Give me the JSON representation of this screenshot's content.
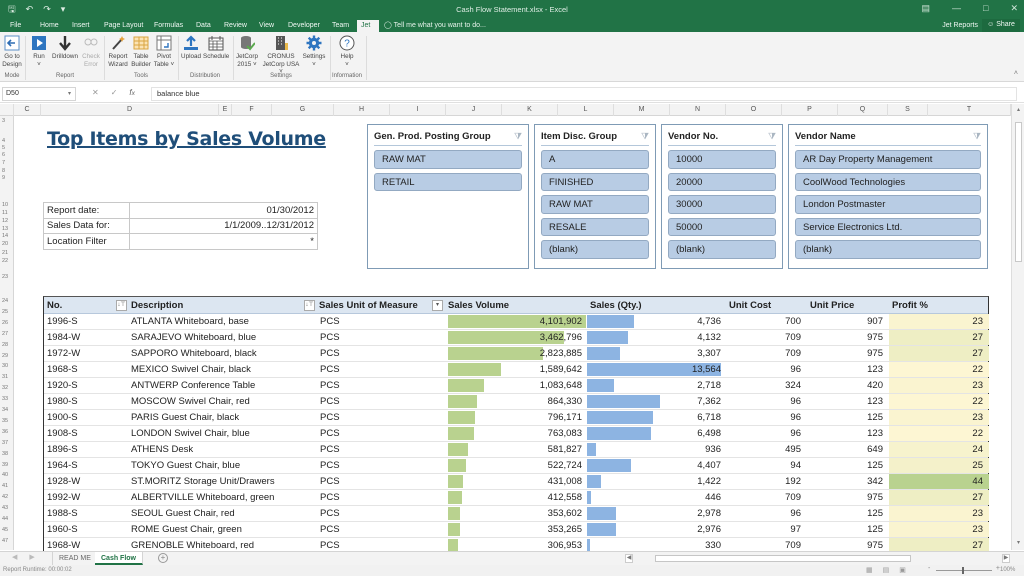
{
  "window": {
    "title": "Cash Flow Statement.xlsx - Excel",
    "qat": [
      "save-icon",
      "undo-icon",
      "redo-icon",
      "customize-icon"
    ],
    "controls": [
      "ribbon-display-icon",
      "minimize-icon",
      "maximize-icon",
      "close-icon"
    ]
  },
  "ribbon_tabs": {
    "items": [
      "File",
      "Home",
      "Insert",
      "Page Layout",
      "Formulas",
      "Data",
      "Review",
      "View",
      "Developer",
      "Team",
      "Jet"
    ],
    "active": "Jet",
    "tell_me": "Tell me what you want to do...",
    "account": "Jet Reports",
    "share": "Share"
  },
  "ribbon": {
    "groups": [
      {
        "name": "Mode",
        "buttons": [
          {
            "label1": "Go to",
            "label2": "Design",
            "icon": "go-to-design-icon"
          }
        ]
      },
      {
        "name": "Report",
        "buttons": [
          {
            "label1": "Run",
            "label2": "˅",
            "icon": "run-icon"
          },
          {
            "label1": "Drilldown",
            "label2": "",
            "icon": "drilldown-icon"
          },
          {
            "label1": "Check",
            "label2": "Error",
            "icon": "check-error-icon"
          }
        ]
      },
      {
        "name": "Tools",
        "buttons": [
          {
            "label1": "Report",
            "label2": "Wizard",
            "icon": "report-wizard-icon"
          },
          {
            "label1": "Table",
            "label2": "Builder",
            "icon": "table-builder-icon"
          },
          {
            "label1": "Pivot",
            "label2": "Table ˅",
            "icon": "pivot-table-icon"
          }
        ]
      },
      {
        "name": "Distribution",
        "buttons": [
          {
            "label1": "Upload",
            "label2": "",
            "icon": "upload-icon"
          },
          {
            "label1": "Schedule",
            "label2": "",
            "icon": "schedule-icon"
          }
        ]
      },
      {
        "name": "Settings",
        "buttons": [
          {
            "label1": "JetCorp",
            "label2": "2015 ˅",
            "icon": "database-icon"
          },
          {
            "label1": "CRONUS",
            "label2": "JetCorp USA ˅",
            "icon": "company-icon"
          },
          {
            "label1": "Settings",
            "label2": "˅",
            "icon": "gear-icon"
          }
        ]
      },
      {
        "name": "Information",
        "buttons": [
          {
            "label1": "Help",
            "label2": "˅",
            "icon": "help-icon"
          }
        ]
      }
    ]
  },
  "formula_bar": {
    "name_box": "D50",
    "formula": "balance blue"
  },
  "columns": [
    "C",
    "D",
    "E",
    "F",
    "G",
    "H",
    "I",
    "J",
    "K",
    "L",
    "M",
    "N",
    "O",
    "P",
    "Q",
    "S",
    "T"
  ],
  "rows": [
    "3",
    "4",
    "5",
    "6",
    "7",
    "8",
    "9",
    "10",
    "11",
    "12",
    "13",
    "14",
    "20",
    "21",
    "22",
    "23",
    "24",
    "25",
    "26",
    "27",
    "28",
    "29",
    "30",
    "31",
    "32",
    "33",
    "34",
    "35",
    "36",
    "37",
    "38",
    "39",
    "40",
    "41",
    "42",
    "43",
    "44",
    "45",
    "47"
  ],
  "sheet": {
    "title": "Top Items by Sales Volume",
    "info": [
      {
        "label": "Report date:",
        "value": "01/30/2012"
      },
      {
        "label": "Sales Data for:",
        "value": "1/1/2009..12/31/2012"
      },
      {
        "label": "Location Filter",
        "value": "*"
      }
    ]
  },
  "slicers": [
    {
      "title": "Gen. Prod. Posting Group",
      "items": [
        "RAW MAT",
        "RETAIL"
      ]
    },
    {
      "title": "Item Disc. Group",
      "items": [
        "A",
        "FINISHED",
        "RAW MAT",
        "RESALE",
        "(blank)"
      ]
    },
    {
      "title": "Vendor No.",
      "items": [
        "10000",
        "20000",
        "30000",
        "50000",
        "(blank)"
      ]
    },
    {
      "title": "Vendor Name",
      "items": [
        "AR Day Property Management",
        "CoolWood Technologies",
        "London Postmaster",
        "Service Electronics Ltd.",
        "(blank)"
      ]
    }
  ],
  "table": {
    "headers": [
      "No.",
      "Description",
      "Sales Unit of Measure",
      "Sales Volume",
      "Sales (Qty.)",
      "Unit Cost",
      "Unit Price",
      "Profit %"
    ],
    "rows": [
      {
        "no": "1996-S",
        "desc": "ATLANTA Whiteboard, base",
        "uom": "PCS",
        "vol": "4,101,902",
        "vol_n": 4101902,
        "qty": "4,736",
        "qty_n": 4736,
        "cost": "700",
        "price": "907",
        "profit": "23",
        "profit_n": 23
      },
      {
        "no": "1984-W",
        "desc": "SARAJEVO Whiteboard, blue",
        "uom": "PCS",
        "vol": "3,462,796",
        "vol_n": 3462796,
        "qty": "4,132",
        "qty_n": 4132,
        "cost": "709",
        "price": "975",
        "profit": "27",
        "profit_n": 27
      },
      {
        "no": "1972-W",
        "desc": "SAPPORO Whiteboard, black",
        "uom": "PCS",
        "vol": "2,823,885",
        "vol_n": 2823885,
        "qty": "3,307",
        "qty_n": 3307,
        "cost": "709",
        "price": "975",
        "profit": "27",
        "profit_n": 27
      },
      {
        "no": "1968-S",
        "desc": "MEXICO Swivel Chair, black",
        "uom": "PCS",
        "vol": "1,589,642",
        "vol_n": 1589642,
        "qty": "13,564",
        "qty_n": 13564,
        "cost": "96",
        "price": "123",
        "profit": "22",
        "profit_n": 22
      },
      {
        "no": "1920-S",
        "desc": "ANTWERP Conference Table",
        "uom": "PCS",
        "vol": "1,083,648",
        "vol_n": 1083648,
        "qty": "2,718",
        "qty_n": 2718,
        "cost": "324",
        "price": "420",
        "profit": "23",
        "profit_n": 23
      },
      {
        "no": "1980-S",
        "desc": "MOSCOW Swivel Chair, red",
        "uom": "PCS",
        "vol": "864,330",
        "vol_n": 864330,
        "qty": "7,362",
        "qty_n": 7362,
        "cost": "96",
        "price": "123",
        "profit": "22",
        "profit_n": 22
      },
      {
        "no": "1900-S",
        "desc": "PARIS Guest Chair, black",
        "uom": "PCS",
        "vol": "796,171",
        "vol_n": 796171,
        "qty": "6,718",
        "qty_n": 6718,
        "cost": "96",
        "price": "125",
        "profit": "23",
        "profit_n": 23
      },
      {
        "no": "1908-S",
        "desc": "LONDON Swivel Chair, blue",
        "uom": "PCS",
        "vol": "763,083",
        "vol_n": 763083,
        "qty": "6,498",
        "qty_n": 6498,
        "cost": "96",
        "price": "123",
        "profit": "22",
        "profit_n": 22
      },
      {
        "no": "1896-S",
        "desc": "ATHENS Desk",
        "uom": "PCS",
        "vol": "581,827",
        "vol_n": 581827,
        "qty": "936",
        "qty_n": 936,
        "cost": "495",
        "price": "649",
        "profit": "24",
        "profit_n": 24
      },
      {
        "no": "1964-S",
        "desc": "TOKYO Guest Chair, blue",
        "uom": "PCS",
        "vol": "522,724",
        "vol_n": 522724,
        "qty": "4,407",
        "qty_n": 4407,
        "cost": "94",
        "price": "125",
        "profit": "25",
        "profit_n": 25
      },
      {
        "no": "1928-W",
        "desc": "ST.MORITZ Storage Unit/Drawers",
        "uom": "PCS",
        "vol": "431,008",
        "vol_n": 431008,
        "qty": "1,422",
        "qty_n": 1422,
        "cost": "192",
        "price": "342",
        "profit": "44",
        "profit_n": 44
      },
      {
        "no": "1992-W",
        "desc": "ALBERTVILLE Whiteboard, green",
        "uom": "PCS",
        "vol": "412,558",
        "vol_n": 412558,
        "qty": "446",
        "qty_n": 446,
        "cost": "709",
        "price": "975",
        "profit": "27",
        "profit_n": 27
      },
      {
        "no": "1988-S",
        "desc": "SEOUL Guest Chair, red",
        "uom": "PCS",
        "vol": "353,602",
        "vol_n": 353602,
        "qty": "2,978",
        "qty_n": 2978,
        "cost": "96",
        "price": "125",
        "profit": "23",
        "profit_n": 23
      },
      {
        "no": "1960-S",
        "desc": "ROME Guest Chair, green",
        "uom": "PCS",
        "vol": "353,265",
        "vol_n": 353265,
        "qty": "2,976",
        "qty_n": 2976,
        "cost": "97",
        "price": "125",
        "profit": "23",
        "profit_n": 23
      },
      {
        "no": "1968-W",
        "desc": "GRENOBLE Whiteboard, red",
        "uom": "PCS",
        "vol": "306,953",
        "vol_n": 306953,
        "qty": "330",
        "qty_n": 330,
        "cost": "709",
        "price": "975",
        "profit": "27",
        "profit_n": 27
      }
    ],
    "colors": {
      "volume_bar": "#b9d28f",
      "qty_bar": "#8db4e2",
      "profit_low": "#fdf6d3",
      "profit_high": "#b9d28f"
    }
  },
  "sheet_tabs": {
    "items": [
      "READ ME",
      "Cash Flow"
    ],
    "active": "Cash Flow"
  },
  "status_bar": {
    "text": "Report Runtime:  00:00:02",
    "zoom": "100%"
  }
}
